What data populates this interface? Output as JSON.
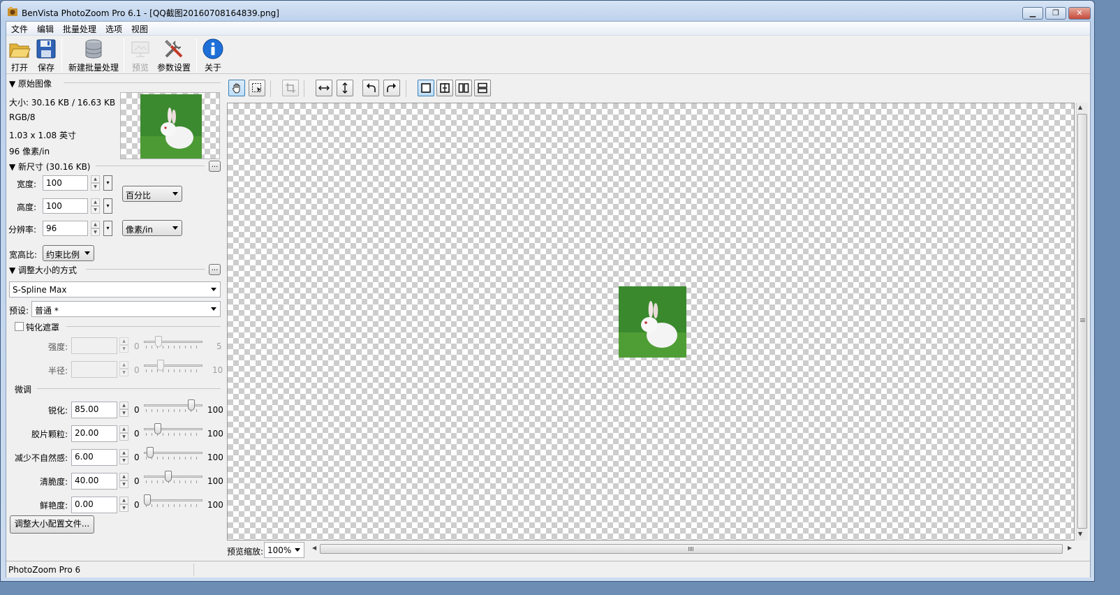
{
  "window": {
    "title": "BenVista PhotoZoom Pro 6.1 - [QQ截图20160708164839.png]"
  },
  "menu": [
    "文件",
    "编辑",
    "批量处理",
    "选项",
    "视图"
  ],
  "toolbar": {
    "open": "打开",
    "save": "保存",
    "new_batch": "新建批量处理",
    "preview": "预览",
    "settings": "参数设置",
    "about": "关于"
  },
  "original": {
    "header": "▼ 原始图像",
    "size": "大小: 30.16 KB / 16.63 KB",
    "mode": "RGB/8",
    "dimensions": "1.03 x 1.08 英寸",
    "resolution": "96 像素/in"
  },
  "new_size": {
    "header": "▼ 新尺寸 (30.16 KB)",
    "more": "...",
    "width_label": "宽度:",
    "width_value": "100",
    "height_label": "高度:",
    "height_value": "100",
    "resolution_label": "分辨率:",
    "resolution_value": "96",
    "unit": "百分比",
    "res_unit": "像素/in",
    "aspect_label": "宽高比:",
    "aspect_value": "约束比例"
  },
  "resize_method": {
    "header": "▼ 调整大小的方式",
    "more": "...",
    "method": "S-Spline Max",
    "preset_label": "预设:",
    "preset_value": "普通 *"
  },
  "unsharp": {
    "header": "钝化遮罩",
    "checked": false,
    "strength_label": "强度:",
    "strength_min": "0",
    "strength_max": "5",
    "strength_level": 0.22,
    "radius_label": "半径:",
    "radius_min": "0",
    "radius_max": "10",
    "radius_level": 0.25
  },
  "fine_tune": {
    "header": "微调",
    "rows": [
      {
        "label": "锐化:",
        "value": "85.00",
        "min": "0",
        "max": "100",
        "level": 0.85
      },
      {
        "label": "胶片颗粒:",
        "value": "20.00",
        "min": "0",
        "max": "100",
        "level": 0.2
      },
      {
        "label": "减少不自然感:",
        "value": "6.00",
        "min": "0",
        "max": "100",
        "level": 0.06
      },
      {
        "label": "清脆度:",
        "value": "40.00",
        "min": "0",
        "max": "100",
        "level": 0.4
      },
      {
        "label": "鲜艳度:",
        "value": "0.00",
        "min": "0",
        "max": "100",
        "level": 0.0
      }
    ],
    "profiles_button": "调整大小配置文件..."
  },
  "preview": {
    "zoom_label": "预览缩放:",
    "zoom_value": "100%"
  },
  "status": {
    "text": "PhotoZoom Pro 6"
  }
}
